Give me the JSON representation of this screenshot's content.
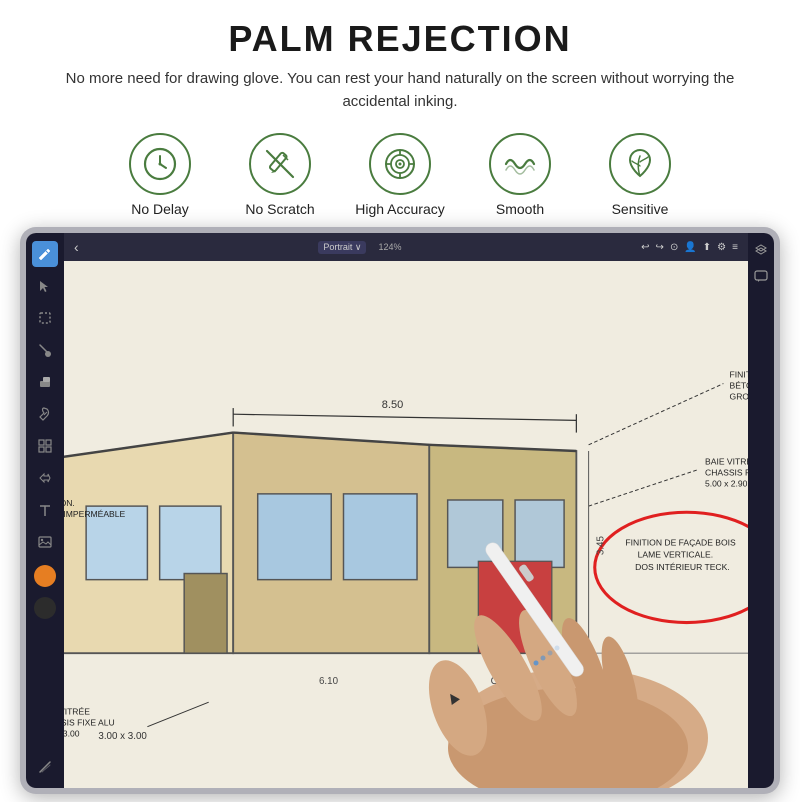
{
  "page": {
    "title": "PALM REJECTION",
    "subtitle": "No more need for drawing glove. You can rest your hand naturally on the screen without worrying the accidental inking.",
    "background_color": "#ffffff"
  },
  "features": [
    {
      "id": "no-delay",
      "label": "No  Delay",
      "icon": "clock-icon"
    },
    {
      "id": "no-scratch",
      "label": "No Scratch",
      "icon": "pencil-slash-icon"
    },
    {
      "id": "high-accuracy",
      "label": "High Accuracy",
      "icon": "target-icon"
    },
    {
      "id": "smooth",
      "label": "Smooth",
      "icon": "wave-icon"
    },
    {
      "id": "sensitive",
      "label": "Sensitive",
      "icon": "leaf-icon"
    }
  ],
  "app": {
    "topbar": {
      "left": "‹",
      "portrait_label": "Portrait ∨",
      "zoom": "124%",
      "right_icons": [
        "↩",
        "↪",
        "⊙",
        "👤",
        "⬆",
        "⚙",
        "≡"
      ]
    }
  },
  "colors": {
    "icon_green": "#4a7c3f",
    "sidebar_dark": "#1a1a2e",
    "topbar_dark": "#2a2a3e",
    "canvas_bg": "#f0ece0"
  }
}
